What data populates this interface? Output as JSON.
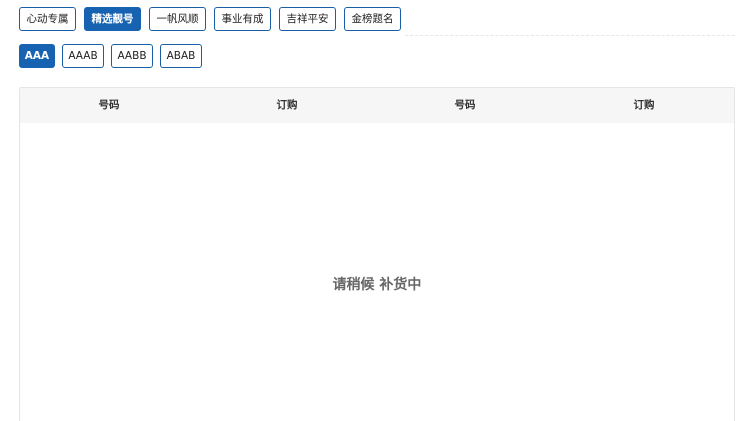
{
  "category_tabs": [
    {
      "label": "心动专属",
      "active": false
    },
    {
      "label": "精选靓号",
      "active": true
    },
    {
      "label": "一帆风顺",
      "active": false
    },
    {
      "label": "事业有成",
      "active": false
    },
    {
      "label": "吉祥平安",
      "active": false
    },
    {
      "label": "金榜题名",
      "active": false
    }
  ],
  "pattern_tabs": [
    {
      "label": "AAA",
      "active": true
    },
    {
      "label": "AAAB",
      "active": false
    },
    {
      "label": "AABB",
      "active": false
    },
    {
      "label": "ABAB",
      "active": false
    }
  ],
  "table": {
    "headers": [
      "号码",
      "订购",
      "号码",
      "订购"
    ],
    "empty_message": "请稍候 补货中"
  },
  "colors": {
    "accent": "#1763b1",
    "border": "#1a5fa6",
    "header_bg": "#f6f6f6"
  }
}
